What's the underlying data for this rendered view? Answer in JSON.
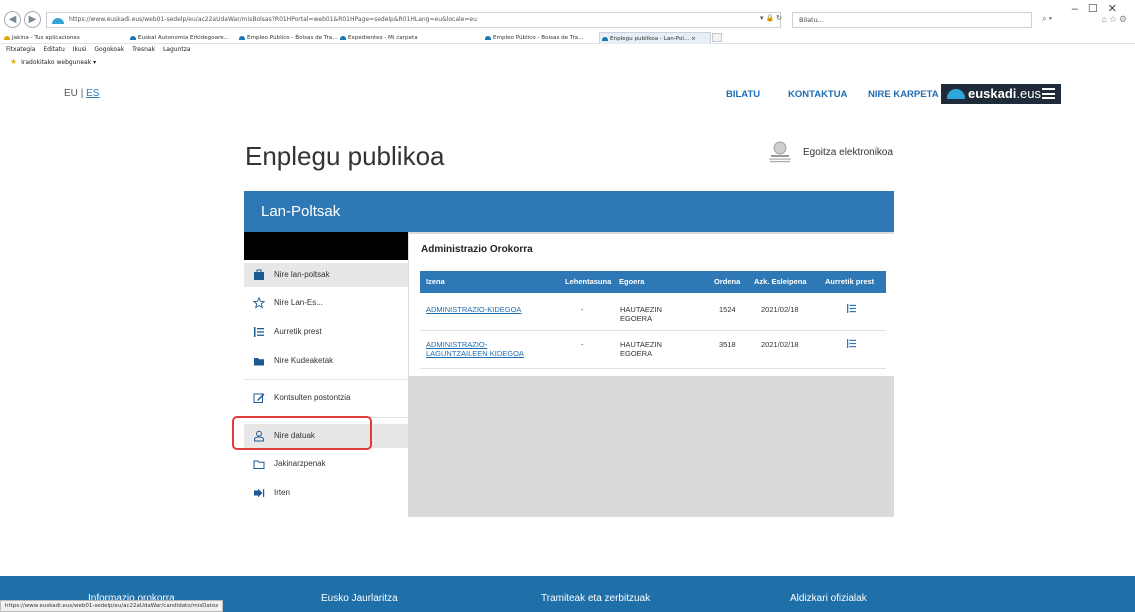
{
  "browser": {
    "url": "https://www.euskadi.eus/web01-sedelp/eu/ac22aUdaWar/misBolsas?R01HPortal=web01&R01HPage=sedelp&R01HLang=eu&locale=eu",
    "search_placeholder": "Bilatu...",
    "tabs": [
      {
        "label": "Jakina - Tus aplicaciones"
      },
      {
        "label": "Euskal Autonomia Erkidegoare..."
      },
      {
        "label": "Empleo Público - Bolsas de Tra..."
      },
      {
        "label": "Expedientes - Mi carpeta"
      },
      {
        "label": "Empleo Público - Bolsas de Tra..."
      },
      {
        "label": "Enplegu publikoa - Lan-Pol... ×"
      }
    ],
    "menu": [
      "Fitxategia",
      "Editatu",
      "Ikusi",
      "Gogokoak",
      "Tresnak",
      "Laguntza"
    ],
    "favorites_label": "Iradokitako webguneak ▾",
    "status_url": "https://www.euskadi.eus/web01-sedelp/eu/ac22aUdaWar/candidato/misDatos"
  },
  "header": {
    "lang_eu": "EU",
    "lang_sep": "|",
    "lang_es": "ES",
    "nav": [
      "BILATU",
      "KONTAKTUA",
      "NIRE KARPETA"
    ],
    "brand_bold": "euskadi",
    "brand_thin": ".eus"
  },
  "page": {
    "title": "Enplegu publikoa",
    "egoitza": "Egoitza elektronikoa"
  },
  "panel": {
    "title": "Lan-Poltsak"
  },
  "sidebar": {
    "items": [
      {
        "label": "Nire lan-poltsak",
        "icon": "briefcase-icon"
      },
      {
        "label": "Nire Lan-Es...",
        "icon": "star-icon"
      },
      {
        "label": "Aurretik prest",
        "icon": "list-icon"
      },
      {
        "label": "Nire Kudeaketak",
        "icon": "folder-icon"
      },
      {
        "label": "Kontsulten postontzia",
        "icon": "edit-icon"
      },
      {
        "label": "Nire datuak",
        "icon": "user-icon"
      },
      {
        "label": "Jakinarzpenak",
        "icon": "folder-outline-icon"
      },
      {
        "label": "Irten",
        "icon": "logout-icon"
      }
    ]
  },
  "table": {
    "title": "Administrazio Orokorra",
    "headers": [
      "Izena",
      "Lehentasuna",
      "Egoera",
      "Ordena",
      "Azk. Esleipena",
      "Aurretik prest"
    ],
    "rows": [
      {
        "name": "ADMINISTRAZIO-KIDEGOA",
        "name2": "",
        "priority": "-",
        "state": "HAUTAEZIN",
        "state2": "EGOERA",
        "order": "1524",
        "date": "2021/02/18"
      },
      {
        "name": "ADMINISTRAZIO-",
        "name2": "LAGUNTZAILEEN KIDEGOA",
        "priority": "-",
        "state": "HAUTAEZIN",
        "state2": "EGOERA",
        "order": "3518",
        "date": "2021/02/18"
      }
    ]
  },
  "footer": {
    "columns": [
      "Informazio orokorra",
      "Eusko Jaurlaritza",
      "Tramiteak eta zerbitzuak",
      "Aldizkari ofizialak"
    ]
  },
  "colors": {
    "primary_blue": "#2e78b5",
    "footer_blue": "#1f6fa9",
    "highlight_red": "#e23b3b"
  }
}
